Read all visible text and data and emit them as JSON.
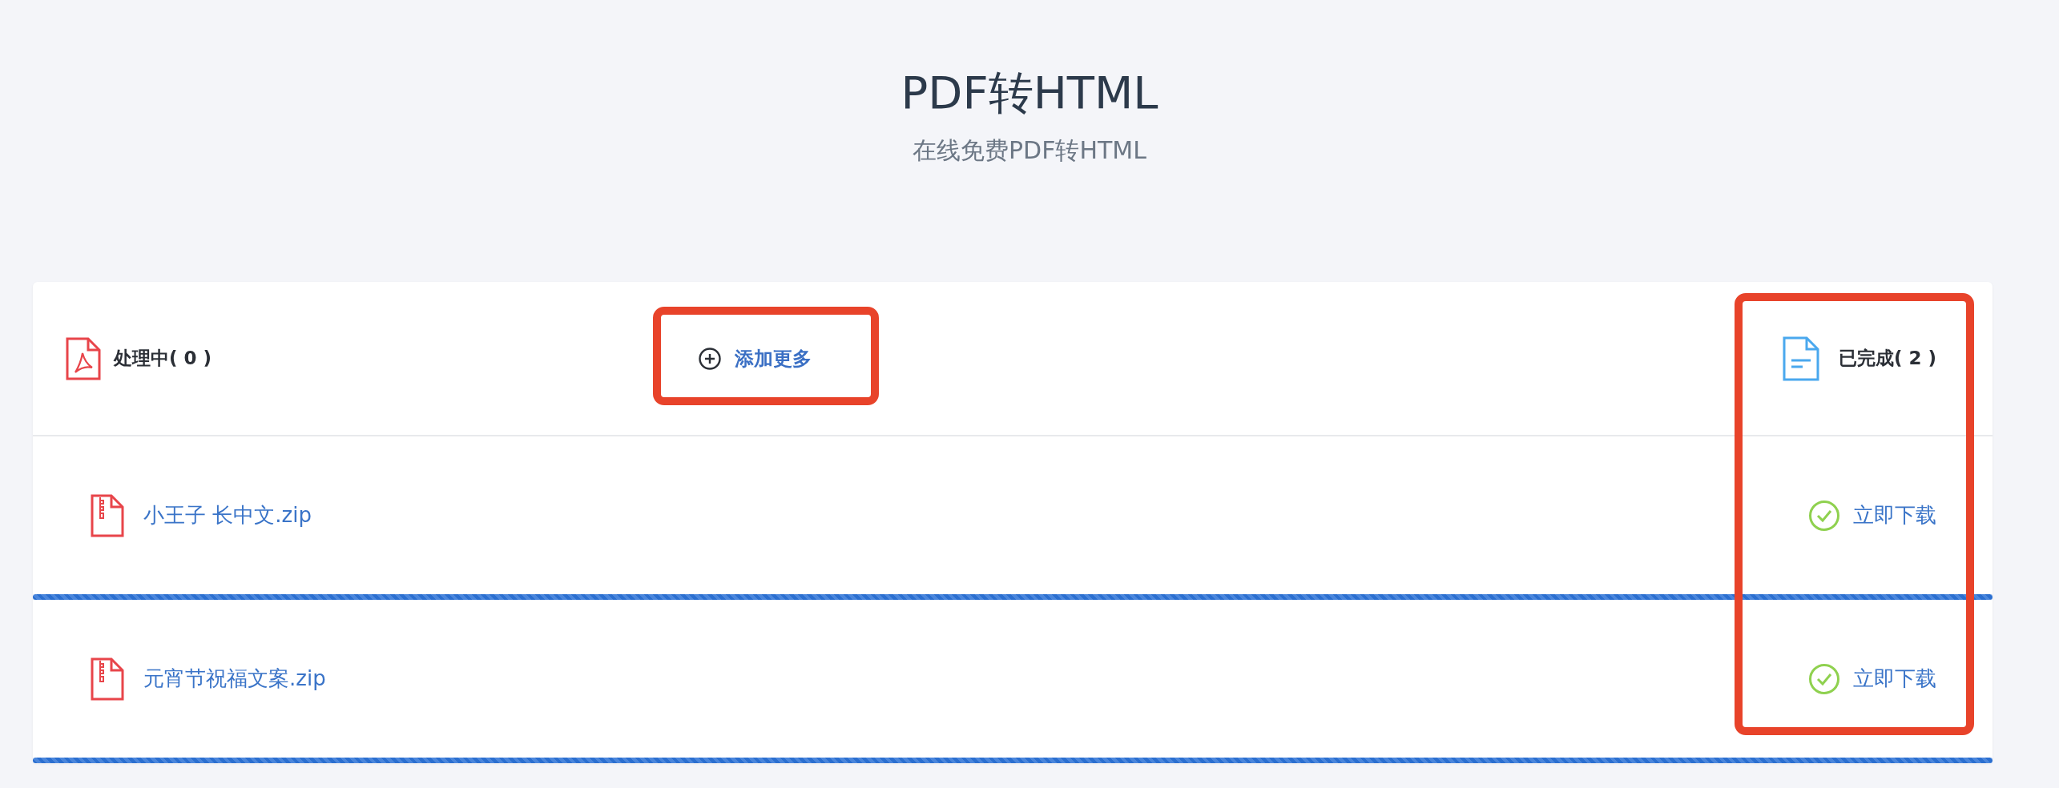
{
  "page": {
    "title": "PDF转HTML",
    "subtitle": "在线免费PDF转HTML"
  },
  "panel": {
    "processing_label": "处理中( 0 )",
    "add_button": "添加更多",
    "completed_label": "已完成( 2 )"
  },
  "files": [
    {
      "name": "小王子 长中文.zip",
      "action": "立即下载",
      "level": 1
    },
    {
      "name": "元宵节祝福文案.zip",
      "action": "立即下载",
      "level": 1
    }
  ]
}
